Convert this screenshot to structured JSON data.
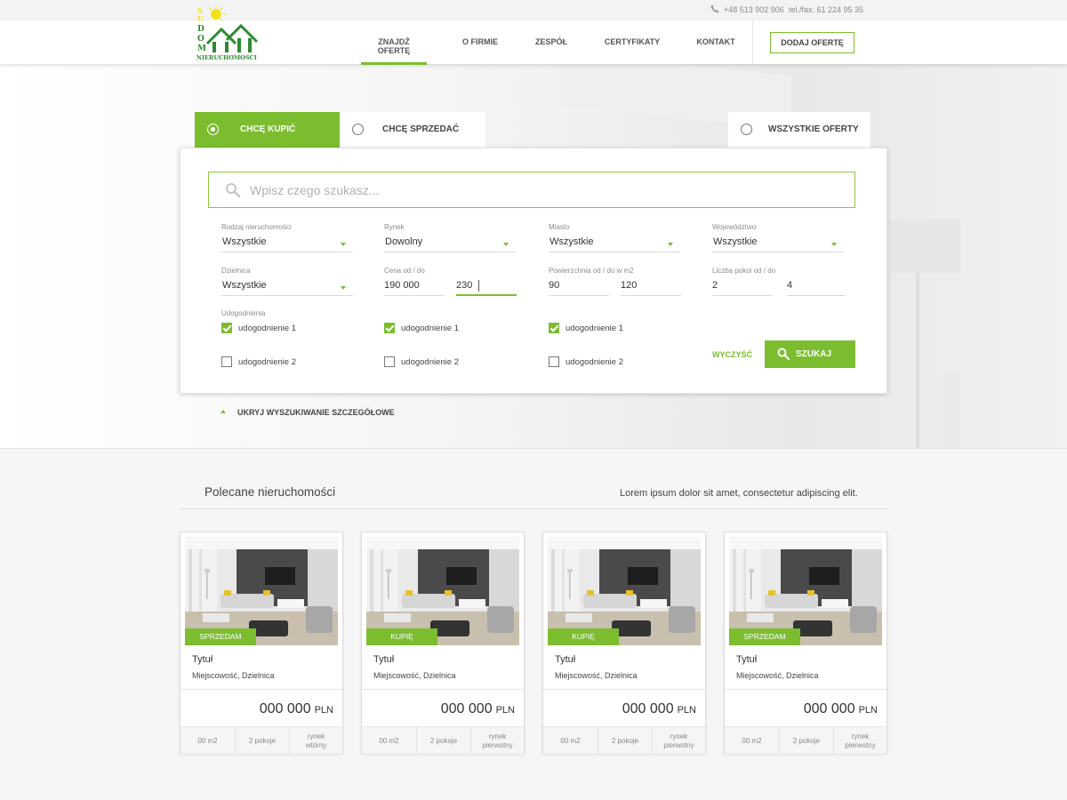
{
  "topbar": {
    "phone": "+48 513 902 906",
    "fax": "tel./fax. 61 224 95 35"
  },
  "logo": {
    "brand": "SUDOM",
    "tagline": "NIERUCHOMOŚCI"
  },
  "nav": {
    "items": [
      "ZNAJDŹ OFERTĘ",
      "O FIRMIE",
      "ZESPÓŁ",
      "CERTYFIKATY",
      "KONTAKT"
    ],
    "active_index": 0,
    "cta": "DODAJ OFERTĘ"
  },
  "search": {
    "tabs": [
      "CHCĘ KUPIĆ",
      "CHCĘ SPRZEDAĆ",
      "WSZYSTKIE OFERTY"
    ],
    "active_tab_index": 0,
    "placeholder": "Wpisz czego szukasz...",
    "fields": {
      "property_type": {
        "label": "Rodzaj nieruchomości",
        "value": "Wszystkie"
      },
      "market": {
        "label": "Rynek",
        "value": "Dowolny"
      },
      "city": {
        "label": "Miasto",
        "value": "Wszystkie"
      },
      "province": {
        "label": "Województwo",
        "value": "Wszystkie"
      },
      "district": {
        "label": "Dzielnica",
        "value": "Wszystkie"
      },
      "price": {
        "label": "Cena od / do",
        "from": "190 000",
        "to": "230"
      },
      "area": {
        "label": "Powierzchnia od / do w m2",
        "from": "90",
        "to": "120"
      },
      "rooms": {
        "label": "Liczba pokoi od / do",
        "from": "2",
        "to": "4"
      }
    },
    "amenities_label": "Udogodnienia",
    "amenities": [
      {
        "label": "udogodnienie 1",
        "checked": true
      },
      {
        "label": "udogodnienie 1",
        "checked": true
      },
      {
        "label": "udogodnienie 1",
        "checked": true
      },
      {
        "label": "udogodnienie 2",
        "checked": false
      },
      {
        "label": "udogodnienie 2",
        "checked": false
      },
      {
        "label": "udogodnienie 2",
        "checked": false
      }
    ],
    "clear_label": "WYCZYŚĆ",
    "submit_label": "SZUKAJ",
    "toggle_advanced": "UKRYJ WYSZUKIWANIE SZCZEGÓŁOWE"
  },
  "featured": {
    "title": "Polecane nieruchomości",
    "subtitle": "Lorem ipsum dolor sit amet, consectetur adipiscing elit.",
    "cards": [
      {
        "badge": "SPRZEDAM",
        "title": "Tytuł",
        "location": "Miejscowość, Dzielnica",
        "price": "000 000",
        "currency": "PLN",
        "area": "00 m2",
        "rooms": "2 pokoje",
        "market_line1": "rynek",
        "market_line2": "wtórny"
      },
      {
        "badge": "KUPIĘ",
        "title": "Tytuł",
        "location": "Miejscowość, Dzielnica",
        "price": "000 000",
        "currency": "PLN",
        "area": "00 m2",
        "rooms": "2 pokoje",
        "market_line1": "rynek",
        "market_line2": "pierwotny"
      },
      {
        "badge": "KUPIĘ",
        "title": "Tytuł",
        "location": "Miejscowość, Dzielnica",
        "price": "000 000",
        "currency": "PLN",
        "area": "00 m2",
        "rooms": "2 pokoje",
        "market_line1": "rynek",
        "market_line2": "pierwotny"
      },
      {
        "badge": "SPRZEDAM",
        "title": "Tytuł",
        "location": "Miejscowość, Dzielnica",
        "price": "000 000",
        "currency": "PLN",
        "area": "00 m2",
        "rooms": "2 pokoje",
        "market_line1": "rynek",
        "market_line2": "pierwotny"
      }
    ]
  },
  "colors": {
    "accent": "#7cbd30",
    "text": "#444444",
    "background": "#f6f6f6"
  }
}
